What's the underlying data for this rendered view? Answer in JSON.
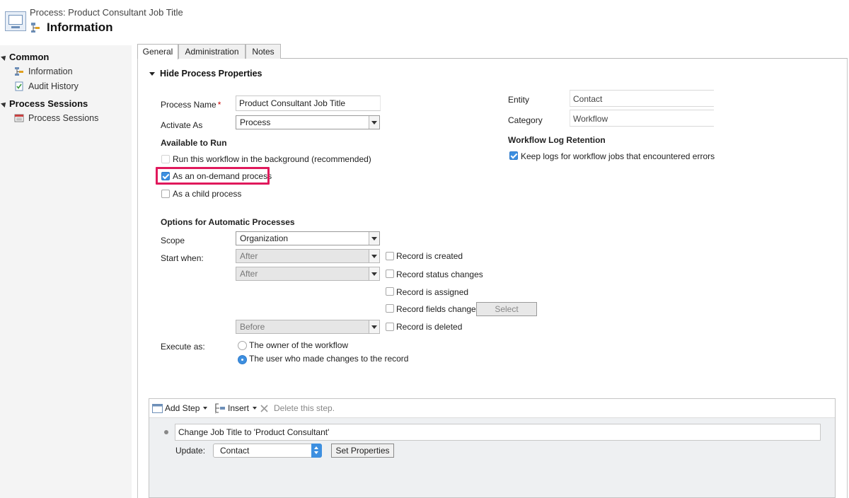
{
  "header": {
    "subtitle": "Process: Product Consultant Job Title",
    "title": "Information"
  },
  "leftnav": {
    "sections": [
      {
        "label": "Common",
        "items": [
          {
            "label": "Information",
            "icon": "workflow-icon"
          },
          {
            "label": "Audit History",
            "icon": "audit-history-icon"
          }
        ]
      },
      {
        "label": "Process Sessions",
        "items": [
          {
            "label": "Process Sessions",
            "icon": "process-sessions-icon"
          }
        ]
      }
    ]
  },
  "tabs": [
    "General",
    "Administration",
    "Notes"
  ],
  "form": {
    "section_toggle": "Hide Process Properties",
    "process_name_label": "Process Name",
    "required_marker": "*",
    "process_name_value": "Product Consultant Job Title",
    "activate_as_label": "Activate As",
    "activate_as_value": "Process",
    "entity_label": "Entity",
    "entity_value": "Contact",
    "category_label": "Category",
    "category_value": "Workflow",
    "available_heading": "Available to Run",
    "run_background_label": "Run this workflow in the background (recommended)",
    "on_demand_label": "As an on-demand process",
    "child_process_label": "As a child process",
    "log_retention_heading": "Workflow Log Retention",
    "keep_logs_label": "Keep logs for workflow jobs that encountered errors",
    "auto_heading": "Options for Automatic Processes",
    "scope_label": "Scope",
    "scope_value": "Organization",
    "start_when_label": "Start when:",
    "start_after_1": "After",
    "start_after_2": "After",
    "start_before": "Before",
    "record_created_label": "Record is created",
    "record_status_label": "Record status changes",
    "record_assigned_label": "Record is assigned",
    "record_fields_label": "Record fields change",
    "select_button": "Select",
    "record_deleted_label": "Record is deleted",
    "execute_as_label": "Execute as:",
    "owner_label": "The owner of the workflow",
    "user_label": "The user who made changes to the record"
  },
  "steps": {
    "add_step": "Add Step",
    "insert": "Insert",
    "delete": "Delete this step.",
    "step_text": "Change Job Title to 'Product Consultant'",
    "update_label": "Update:",
    "update_value": "Contact",
    "set_properties": "Set Properties"
  },
  "colors": {
    "accent": "#3d8fe0",
    "highlight": "#e0195c",
    "required": "#cc0000"
  }
}
